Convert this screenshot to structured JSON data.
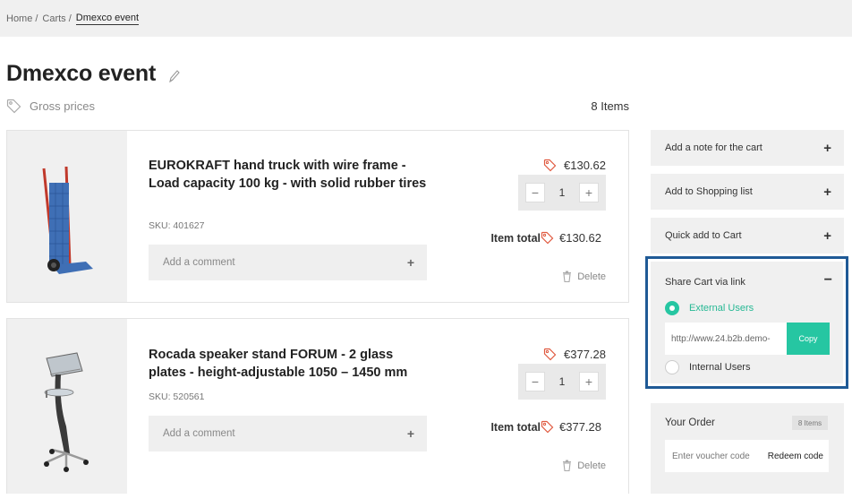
{
  "breadcrumb": {
    "items": [
      {
        "label": "Home"
      },
      {
        "label": "Carts"
      }
    ],
    "separator": "/",
    "current": "Dmexco event"
  },
  "page": {
    "title": "Dmexco event",
    "price_mode": "Gross prices",
    "items_count": "8 Items"
  },
  "products": [
    {
      "name": "EUROKRAFT hand truck with wire frame - Load capacity 100 kg - with solid rubber tires",
      "sku": "SKU: 401627",
      "unit_price": "€130.62",
      "quantity": "1",
      "qty_minus": "−",
      "qty_plus": "+",
      "item_total_label": "Item total",
      "item_total": "€130.62",
      "comment_placeholder": "Add a comment",
      "comment_icon": "+",
      "delete_label": "Delete"
    },
    {
      "name": "Rocada speaker stand FORUM - 2 glass plates - height-adjustable 1050 – 1450 mm",
      "sku": "SKU: 520561",
      "unit_price": "€377.28",
      "quantity": "1",
      "qty_minus": "−",
      "qty_plus": "+",
      "item_total_label": "Item total",
      "item_total": "€377.28",
      "comment_placeholder": "Add a comment",
      "comment_icon": "+",
      "delete_label": "Delete"
    }
  ],
  "sidebar": {
    "panels": [
      {
        "label": "Add a note for the cart",
        "control": "+"
      },
      {
        "label": "Add to Shopping list",
        "control": "+"
      },
      {
        "label": "Quick add to Cart",
        "control": "+"
      }
    ],
    "share": {
      "label": "Share Cart via link",
      "control": "−",
      "external_label": "External Users",
      "internal_label": "Internal Users",
      "link_value": "http://www.24.b2b.demo-",
      "copy_label": "Copy",
      "accent": "#26c6a2",
      "highlight": "#1f5a96"
    },
    "order": {
      "label": "Your Order",
      "badge": "8 Items",
      "voucher_placeholder": "Enter voucher code",
      "redeem_label": "Redeem code"
    }
  }
}
